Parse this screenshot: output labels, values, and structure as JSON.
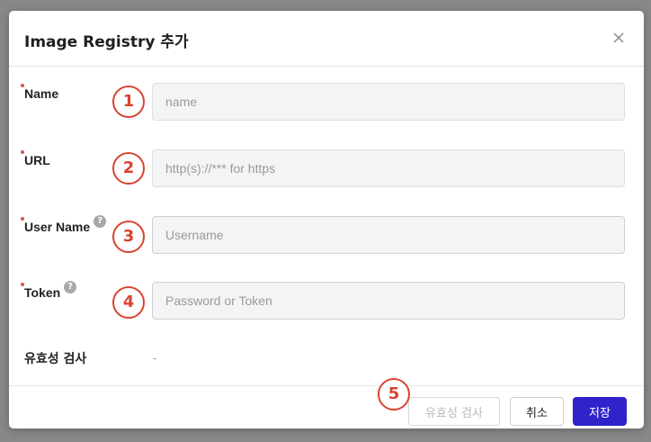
{
  "dialog": {
    "title": "Image Registry 추가",
    "close_icon": "close-icon"
  },
  "fields": [
    {
      "label": "Name",
      "placeholder": "name",
      "required": true,
      "help": false,
      "marker": "1"
    },
    {
      "label": "URL",
      "placeholder": "http(s)://*** for https",
      "required": true,
      "help": false,
      "marker": "2"
    },
    {
      "label": "User Name",
      "placeholder": "Username",
      "required": true,
      "help": true,
      "marker": "3"
    },
    {
      "label": "Token",
      "placeholder": "Password or Token",
      "required": true,
      "help": true,
      "marker": "4"
    }
  ],
  "help_icon_glyph": "?",
  "validation": {
    "label": "유효성 검사",
    "value": "-"
  },
  "footer": {
    "marker": "5",
    "validate_label": "유효성 검사",
    "cancel_label": "취소",
    "save_label": "저장"
  },
  "colors": {
    "primary": "#2f23c9",
    "marker": "#d9432f",
    "required": "#d9534f"
  }
}
